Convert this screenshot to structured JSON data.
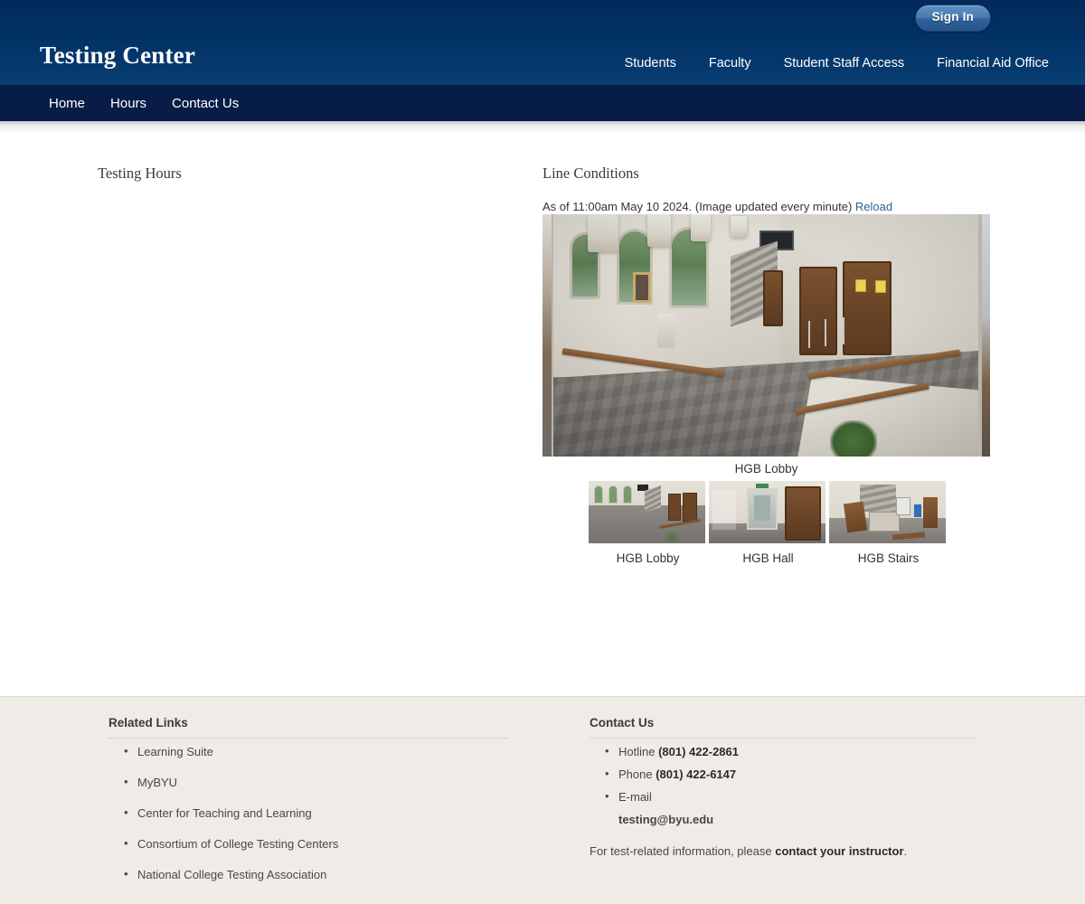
{
  "header": {
    "title": "Testing Center",
    "sign_in_label": "Sign In",
    "audience_links": [
      {
        "label": "Students"
      },
      {
        "label": "Faculty"
      },
      {
        "label": "Student Staff Access"
      },
      {
        "label": "Financial Aid Office"
      }
    ]
  },
  "main_nav": [
    {
      "label": "Home"
    },
    {
      "label": "Hours"
    },
    {
      "label": "Contact Us"
    }
  ],
  "main": {
    "hours_heading": "Testing Hours",
    "line_heading": "Line Conditions",
    "cam_status_text": "As of 11:00am May 10 2024. (Image updated every minute)",
    "cam_reload_label": "Reload",
    "cam_main_caption": "HGB Lobby",
    "thumbnails": [
      {
        "label": "HGB Lobby"
      },
      {
        "label": "HGB Hall"
      },
      {
        "label": "HGB Stairs"
      }
    ]
  },
  "footer": {
    "related_links_heading": "Related Links",
    "related_links": [
      {
        "label": "Learning Suite"
      },
      {
        "label": "MyBYU"
      },
      {
        "label": "Center for Teaching and Learning"
      },
      {
        "label": "Consortium of College Testing Centers"
      },
      {
        "label": "National College Testing Association"
      }
    ],
    "contact_heading": "Contact Us",
    "contact_items": [
      {
        "label": "Hotline",
        "value": "(801) 422-2861"
      },
      {
        "label": "Phone",
        "value": "(801) 422-6147"
      },
      {
        "label": "E-mail",
        "value": ""
      }
    ],
    "email_value": "testing@byu.edu",
    "note_prefix": "For test-related information, please ",
    "note_bold": "contact your instructor",
    "note_suffix": "."
  },
  "colors": {
    "header_top": "#012a5b",
    "header_bottom": "#0a4073",
    "nav_bar": "#071c46",
    "link_blue": "#2a6496",
    "footer_bg": "#efebe7",
    "text_dark": "#3a3a3a"
  }
}
